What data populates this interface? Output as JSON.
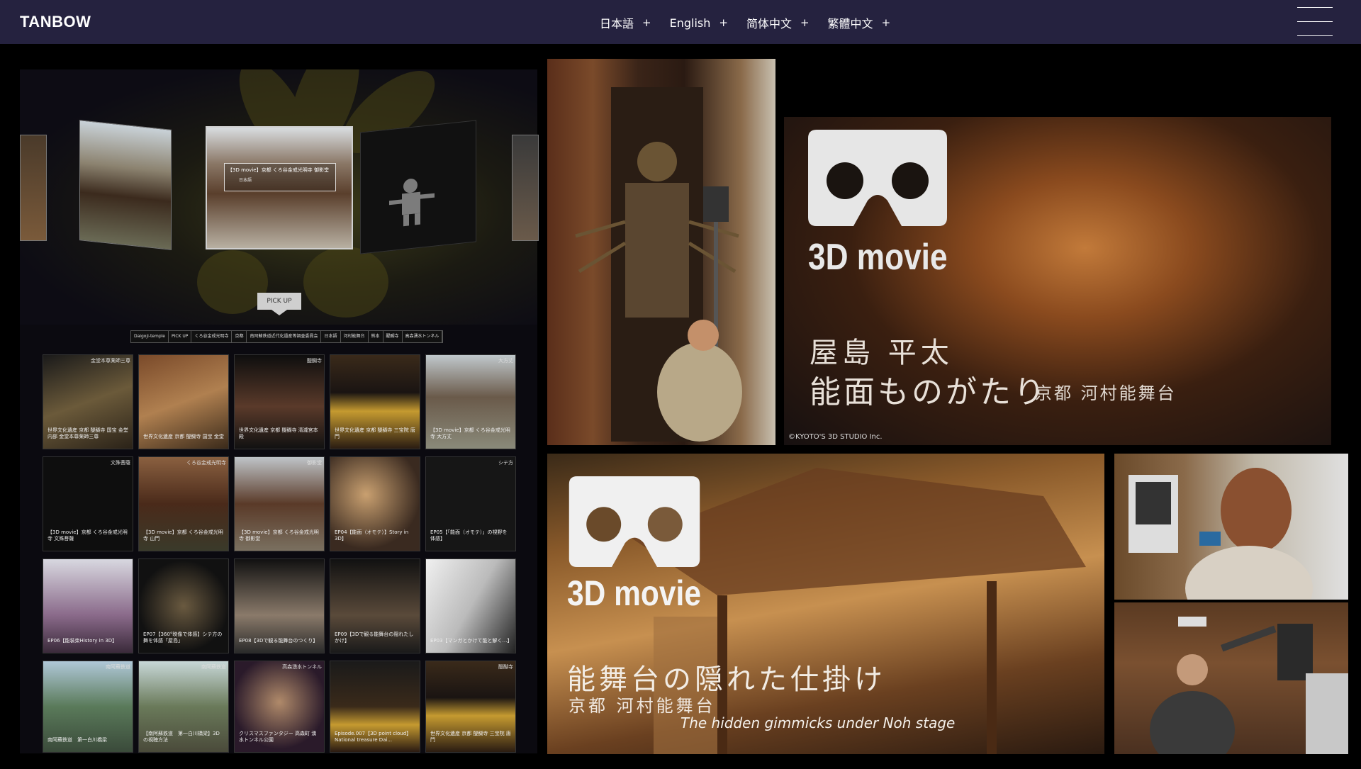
{
  "header": {
    "logo": "TANBOW",
    "languages": [
      {
        "label": "日本語",
        "plus": "+"
      },
      {
        "label": "English",
        "plus": "+"
      },
      {
        "label": "简体中文",
        "plus": "+"
      },
      {
        "label": "繁體中文",
        "plus": "+"
      }
    ]
  },
  "gallery": {
    "carousel_caption": "【3D movie】京都 くろ谷金戒光明寺 御影堂",
    "carousel_tag": "日本語",
    "pickup_label": "PICK UP",
    "categories": [
      "Daigoji-temple",
      "PICK UP",
      "くろ谷金戒光明寺",
      "京都",
      "南阿蘇鉄道近代化遺産等調査委員会",
      "日本語",
      "河村能舞台",
      "熊本",
      "醍醐寺",
      "高森湧水トンネル"
    ],
    "thumbs": [
      {
        "tag": "金堂本尊薬師三尊",
        "title": "世界文化遺産 京都 醍醐寺 国宝 金堂内部 金堂本尊薬師三尊"
      },
      {
        "tag": "",
        "title": "世界文化遺産 京都 醍醐寺 国宝 金堂"
      },
      {
        "tag": "醍醐寺",
        "title": "世界文化遺産 京都 醍醐寺 清瀧宮本殿"
      },
      {
        "tag": "",
        "title": "世界文化遺産 京都 醍醐寺 三宝院 唐門"
      },
      {
        "tag": "大方丈",
        "title": "【3D movie】京都 くろ谷金戒光明寺 大方丈"
      },
      {
        "tag": "文殊菩薩",
        "title": "【3D movie】京都 くろ谷金戒光明寺 文殊菩薩"
      },
      {
        "tag": "くろ谷金戒光明寺",
        "title": "【3D movie】京都 くろ谷金戒光明寺 山門"
      },
      {
        "tag": "御影堂",
        "title": "【3D movie】京都 くろ谷金戒光明寺 御影堂"
      },
      {
        "tag": "",
        "title": "EP04【能面（オモテ）】Story in 3D】"
      },
      {
        "tag": "シテ方",
        "title": "EP05【「能面（オモテ）」の視野を体感】"
      },
      {
        "tag": "",
        "title": "EP06【能装束History in 3D】"
      },
      {
        "tag": "",
        "title": "EP07【360°映像で体感】シテ方の舞を体感「屋島」"
      },
      {
        "tag": "",
        "title": "EP08【3Dで観る能舞台のつくり】"
      },
      {
        "tag": "",
        "title": "EP09【3Dで観る能舞台の隠れたしかけ】"
      },
      {
        "tag": "",
        "title": "EP03【マンガとかけて能と解く…】"
      },
      {
        "tag": "南阿蘇鉄道",
        "title": "南阿蘇鉄道　第一白川橋梁"
      },
      {
        "tag": "南阿蘇鉄道",
        "title": "【南阿蘇鉄道　第一白川橋梁】3Dの視聴方法"
      },
      {
        "tag": "高森湧水トンネル",
        "title": "クリスマスファンタジー 高森町 湧水トンネル公園"
      },
      {
        "tag": "",
        "title": "Episode.007【3D point cloud】National treasure Dai..."
      },
      {
        "tag": "醍醐寺",
        "title": "世界文化遺産 京都 醍醐寺 三宝院 唐門"
      }
    ]
  },
  "right_top_banner": {
    "vr_label": "3D movie",
    "title_line1": "屋島 平太",
    "title_line2": "能面ものがたり",
    "subtitle": "京都 河村能舞台",
    "copyright": "©KYOTO'S 3D STUDIO Inc."
  },
  "bottom_banner": {
    "vr_label": "3D movie",
    "title": "能舞台の隠れた仕掛け",
    "subtitle": "京都 河村能舞台",
    "english": "The hidden gimmicks under Noh stage"
  },
  "colors": {
    "header_bg": "#25223f",
    "page_bg": "#000000"
  }
}
